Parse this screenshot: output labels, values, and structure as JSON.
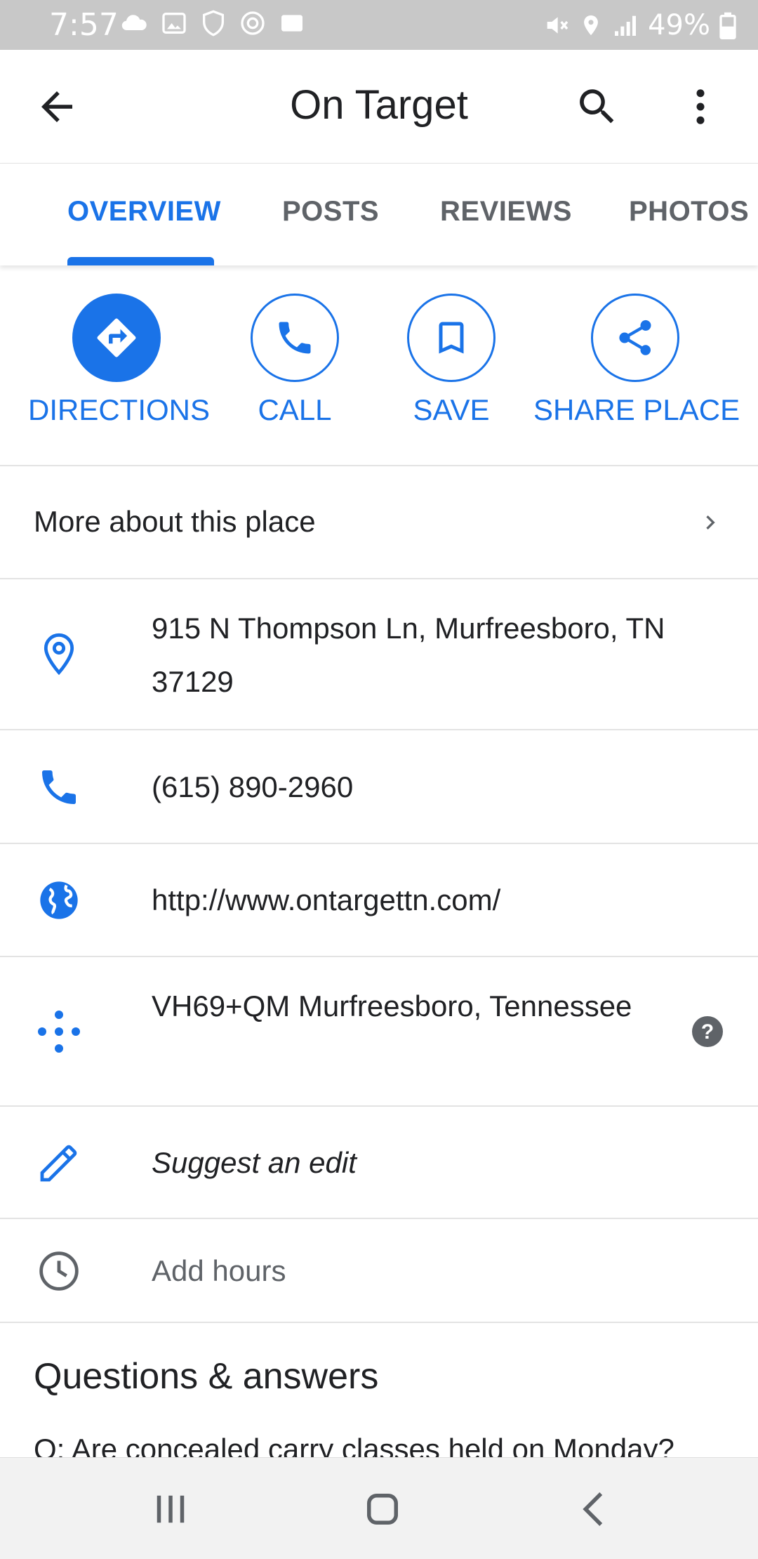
{
  "status_bar": {
    "time": "7:57",
    "battery": "49%",
    "icons_left": [
      "cloud-icon",
      "image-icon",
      "shield-icon",
      "at-icon",
      "sync-icon"
    ],
    "icons_right": [
      "mute-icon",
      "location-icon",
      "signal-icon",
      "battery-icon"
    ]
  },
  "app_bar": {
    "title": "On Target"
  },
  "tabs": [
    {
      "label": "OVERVIEW",
      "active": true
    },
    {
      "label": "POSTS",
      "active": false
    },
    {
      "label": "REVIEWS",
      "active": false
    },
    {
      "label": "PHOTOS",
      "active": false
    }
  ],
  "actions": [
    {
      "label": "DIRECTIONS",
      "icon": "directions-icon"
    },
    {
      "label": "CALL",
      "icon": "phone-icon"
    },
    {
      "label": "SAVE",
      "icon": "bookmark-icon"
    },
    {
      "label": "SHARE PLACE",
      "icon": "share-icon"
    }
  ],
  "more_about": "More about this place",
  "details": {
    "address": "915 N Thompson Ln, Murfreesboro, TN 37129",
    "phone": "(615) 890-2960",
    "website": "http://www.ontargettn.com/",
    "plus_code": "VH69+QM Murfreesboro, Tennessee",
    "suggest_edit": "Suggest an edit",
    "add_hours": "Add hours"
  },
  "questions": {
    "title": "Questions & answers",
    "preview": "Q: Are concealed carry classes held on Monday?"
  },
  "colors": {
    "accent": "#1a73e8",
    "text": "#202124",
    "muted": "#5f6368"
  }
}
